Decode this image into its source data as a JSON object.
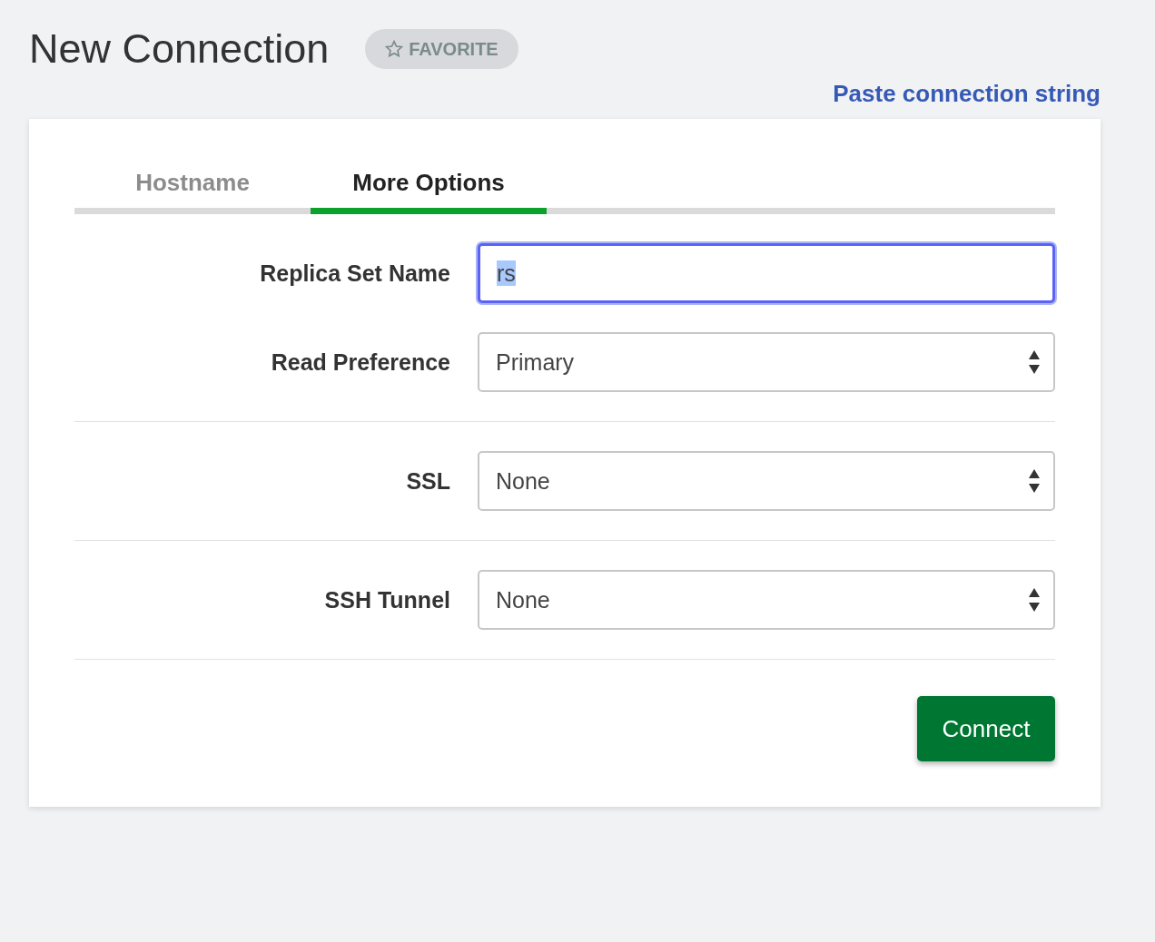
{
  "title": "New Connection",
  "favorite": {
    "label": "FAVORITE",
    "on": false
  },
  "paste_link": "Paste connection string",
  "tabs": [
    {
      "label": "Hostname",
      "selected": false
    },
    {
      "label": "More Options",
      "selected": true
    }
  ],
  "sections": [
    {
      "fields": [
        {
          "kind": "text",
          "label": "Replica Set Name",
          "value": "rs",
          "focused": true
        },
        {
          "kind": "select",
          "label": "Read Preference",
          "value": "Primary"
        }
      ]
    },
    {
      "fields": [
        {
          "kind": "select",
          "label": "SSL",
          "value": "None"
        }
      ]
    },
    {
      "fields": [
        {
          "kind": "select",
          "label": "SSH Tunnel",
          "value": "None"
        }
      ]
    }
  ],
  "connect_button": "Connect"
}
